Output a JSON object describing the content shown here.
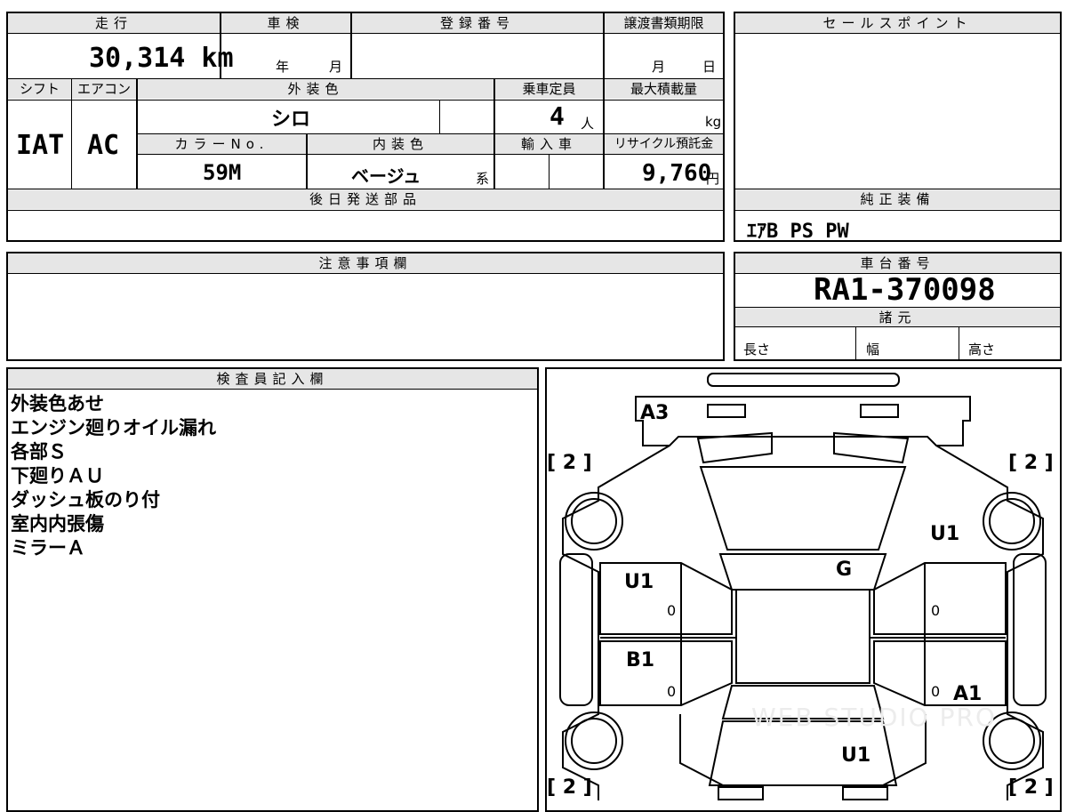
{
  "headers": {
    "mileage": "走行",
    "inspection": "車検",
    "registration": "登録番号",
    "transfer_deadline": "譲渡書類期限",
    "sales_point": "セールスポイント",
    "shift": "シフト",
    "aircon": "エアコン",
    "exterior_color": "外装色",
    "capacity": "乗車定員",
    "max_load": "最大積載量",
    "color_no": "カラーNo.",
    "interior_color": "内装色",
    "import": "輸入車",
    "recycle_fee": "リサイクル預託金",
    "later_parts": "後日発送部品",
    "genuine_equipment": "純正装備",
    "caution": "注意事項欄",
    "chassis_no": "車台番号",
    "specs": "諸元",
    "inspector": "検査員記入欄"
  },
  "values": {
    "mileage": "30,314 km",
    "inspection_year": "年",
    "inspection_month": "月",
    "transfer_month": "月",
    "transfer_day": "日",
    "shift": "IAT",
    "aircon": "AC",
    "exterior_color": "シロ",
    "capacity": "4",
    "capacity_unit": "人",
    "max_load_unit": "kg",
    "color_no": "59M",
    "interior_color": "ベージュ",
    "interior_suffix": "系",
    "recycle_fee": "9,760",
    "recycle_unit": "円",
    "genuine_equipment": "ｴｱB  PS  PW",
    "chassis_no": "RA1-370098",
    "length_label": "長さ",
    "width_label": "幅",
    "height_label": "高さ"
  },
  "inspector_notes": [
    "外装色あせ",
    "エンジン廻りオイル漏れ",
    "各部Ｓ",
    "下廻りＡＵ",
    "ダッシュ板のり付",
    "室内内張傷",
    "ミラーＡ"
  ],
  "diagram": {
    "tire_left_front": "[ 2 ]",
    "tire_right_front": "[ 2 ]",
    "tire_left_rear": "[ 2 ]",
    "tire_right_rear": "[ 2 ]",
    "front_bumper": "A3",
    "hood": "U1",
    "roof": "G",
    "left_front_door": "U1",
    "left_rear_door": "B1",
    "right_rear_door": "A1",
    "rear": "U1",
    "zero_1": "0",
    "zero_2": "0",
    "zero_3": "0",
    "zero_4": "0",
    "watermark": "WEB STUDIO PRO"
  }
}
